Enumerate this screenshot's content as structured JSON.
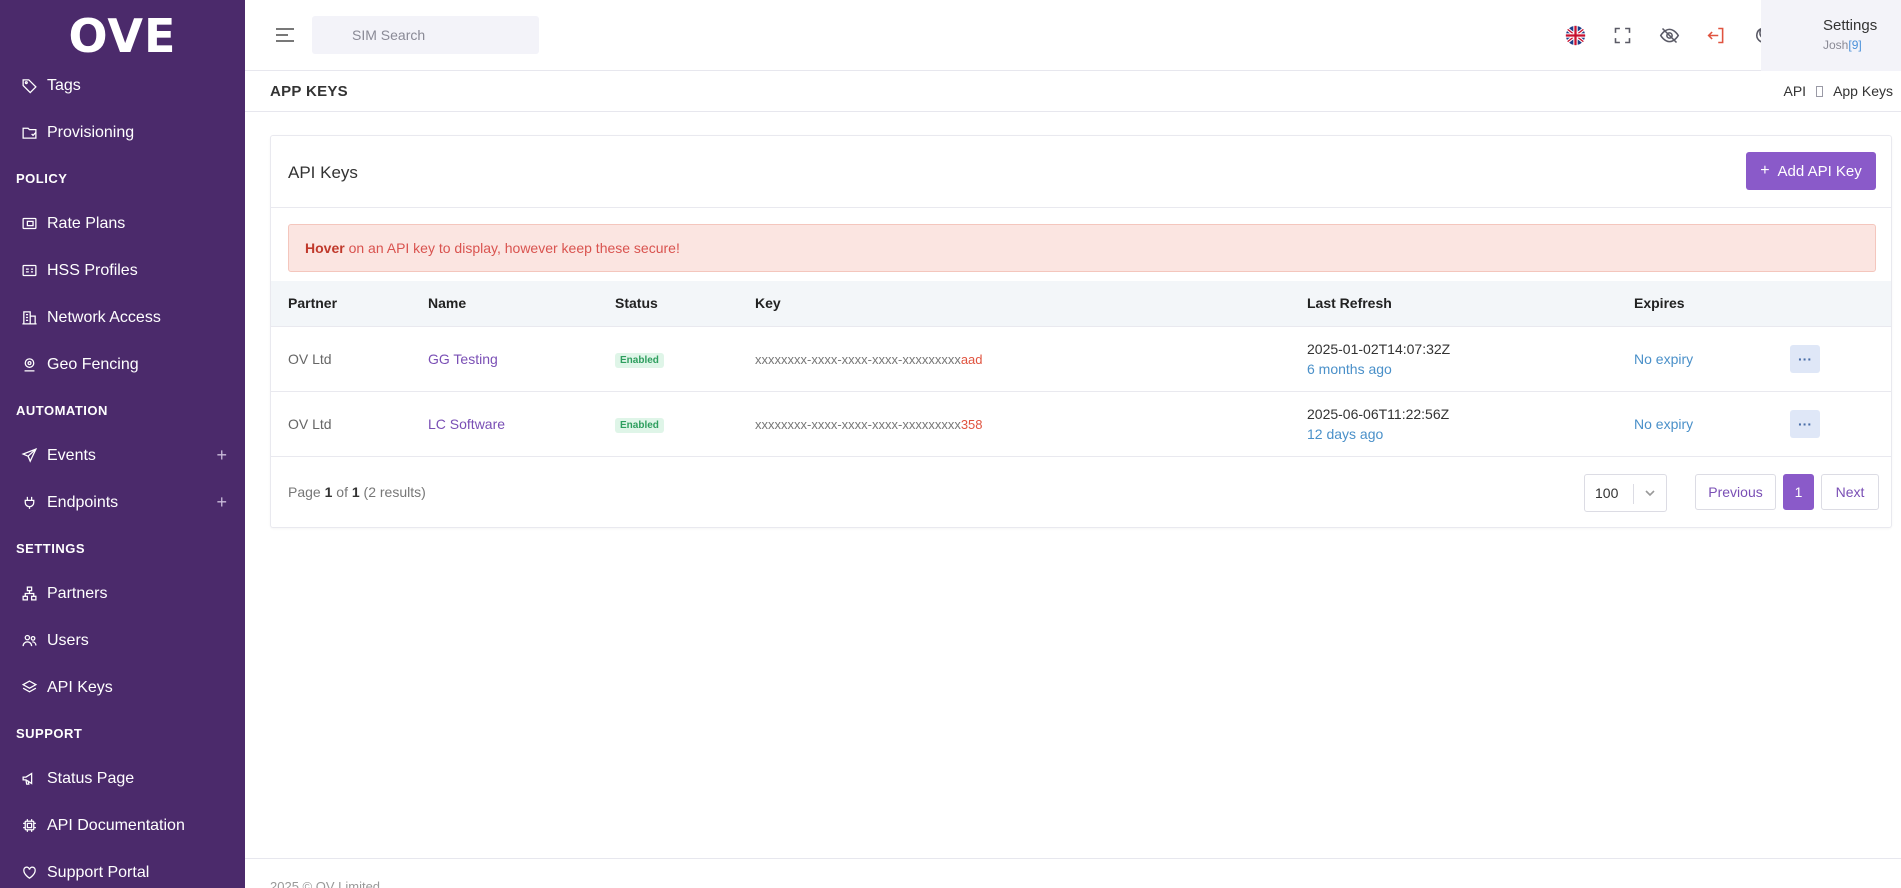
{
  "sidebar": {
    "logo": "OVE",
    "items": [
      {
        "label": "Tags",
        "icon": "tag-icon"
      },
      {
        "label": "Provisioning",
        "icon": "provisioning-icon"
      }
    ],
    "sections": [
      {
        "title": "POLICY",
        "items": [
          {
            "label": "Rate Plans",
            "icon": "wallet-icon"
          },
          {
            "label": "HSS Profiles",
            "icon": "id-card-icon"
          },
          {
            "label": "Network Access",
            "icon": "building-icon"
          },
          {
            "label": "Geo Fencing",
            "icon": "location-icon"
          }
        ]
      },
      {
        "title": "AUTOMATION",
        "items": [
          {
            "label": "Events",
            "icon": "send-icon",
            "expandable": "+"
          },
          {
            "label": "Endpoints",
            "icon": "plug-icon",
            "expandable": "+"
          }
        ]
      },
      {
        "title": "SETTINGS",
        "items": [
          {
            "label": "Partners",
            "icon": "network-icon"
          },
          {
            "label": "Users",
            "icon": "users-icon"
          },
          {
            "label": "API Keys",
            "icon": "layers-icon"
          }
        ]
      },
      {
        "title": "SUPPORT",
        "items": [
          {
            "label": "Status Page",
            "icon": "megaphone-icon"
          },
          {
            "label": "API Documentation",
            "icon": "chip-icon"
          },
          {
            "label": "Support Portal",
            "icon": "heart-icon"
          }
        ]
      }
    ]
  },
  "topbar": {
    "search_placeholder": "SIM Search",
    "settings_label": "Settings",
    "user_name": "Josh",
    "user_count": "[9]"
  },
  "page": {
    "title": "APP KEYS",
    "breadcrumb": [
      "API",
      "App Keys"
    ]
  },
  "card": {
    "title": "API Keys",
    "add_button": "Add API Key",
    "alert_bold": "Hover",
    "alert_text": " on an API key to display, however keep these secure!",
    "columns": [
      "Partner",
      "Name",
      "Status",
      "Key",
      "Last Refresh",
      "Expires"
    ],
    "rows": [
      {
        "partner": "OV Ltd",
        "name": "GG Testing",
        "status": "Enabled",
        "key_mask": "xxxxxxxx-xxxx-xxxx-xxxx-xxxxxxxxx",
        "key_end": "aad",
        "refresh": "2025-01-02T14:07:32Z",
        "refresh_ago": "6 months ago",
        "expires": "No expiry",
        "actions": "···"
      },
      {
        "partner": "OV Ltd",
        "name": "LC Software",
        "status": "Enabled",
        "key_mask": "xxxxxxxx-xxxx-xxxx-xxxx-xxxxxxxxx",
        "key_end": "358",
        "refresh": "2025-06-06T11:22:56Z",
        "refresh_ago": "12 days ago",
        "expires": "No expiry",
        "actions": "···"
      }
    ],
    "pagination": {
      "page_word": "Page",
      "current": "1",
      "of_word": "of",
      "total": "1",
      "results": "(2 results)",
      "per_page": "100",
      "previous": "Previous",
      "page_button": "1",
      "next": "Next"
    }
  },
  "footer": {
    "text": "2025 © OV Limited"
  },
  "colors": {
    "sidebar_bg": "#4b2a6b",
    "accent": "#8a5ac9",
    "alert_bg": "#fbe5e1",
    "alert_text": "#d9534f",
    "success": "#2e9e5e",
    "link": "#4a90c9"
  }
}
